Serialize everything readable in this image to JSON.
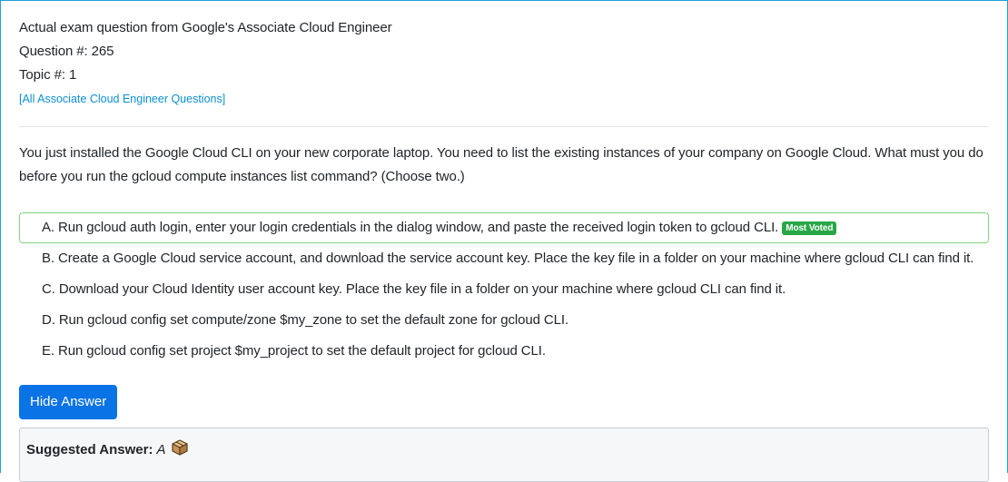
{
  "header": {
    "title_line": "Actual exam question from Google's Associate Cloud Engineer",
    "question_number": "Question #: 265",
    "topic_number": "Topic #: 1",
    "all_questions_link": "[All Associate Cloud Engineer Questions]"
  },
  "question": {
    "text": "You just installed the Google Cloud CLI on your new corporate laptop. You need to list the existing instances of your company on Google Cloud. What must you do before you run the gcloud compute instances list command? (Choose two.)"
  },
  "choices": [
    {
      "letter": "A.",
      "text": "Run gcloud auth login, enter your login credentials in the dialog window, and paste the received login token to gcloud CLI.",
      "badge": "Most Voted"
    },
    {
      "letter": "B.",
      "text": "Create a Google Cloud service account, and download the service account key. Place the key file in a folder on your machine where gcloud CLI can find it."
    },
    {
      "letter": "C.",
      "text": "Download your Cloud Identity user account key. Place the key file in a folder on your machine where gcloud CLI can find it."
    },
    {
      "letter": "D.",
      "text": "Run gcloud config set compute/zone $my_zone to set the default zone for gcloud CLI."
    },
    {
      "letter": "E.",
      "text": "Run gcloud config set project $my_project to set the default project for gcloud CLI."
    }
  ],
  "actions": {
    "hide_answer_label": "Hide Answer"
  },
  "suggested_answer": {
    "label": "Suggested Answer:",
    "value": "A",
    "icon": "package-box-icon"
  },
  "colors": {
    "accent_border": "#20a0d8",
    "link": "#0d8ed6",
    "button": "#0a73e6",
    "correct_border": "#7fd47f",
    "badge": "#28a745"
  }
}
